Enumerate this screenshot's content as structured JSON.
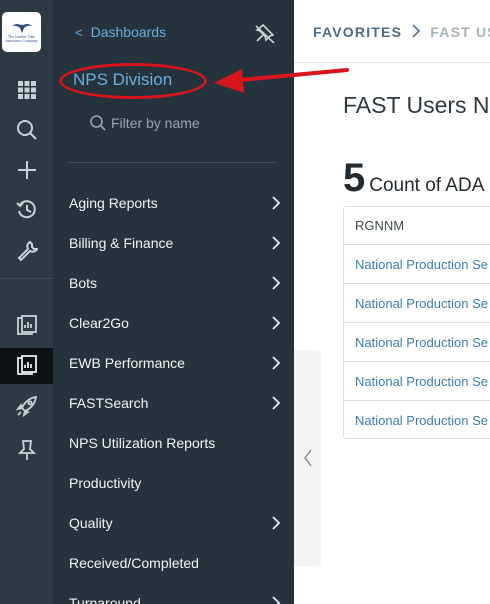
{
  "logo": {
    "text": "The Lender Title Insurance Company"
  },
  "rail": {
    "items": [
      {
        "icon": "apps-grid-icon"
      },
      {
        "icon": "search-icon"
      },
      {
        "icon": "plus-icon"
      },
      {
        "icon": "history-icon"
      },
      {
        "icon": "wrench-icon"
      },
      {
        "icon": "dashboard-icon"
      },
      {
        "icon": "dashboard-icon",
        "active": true
      },
      {
        "icon": "rocket-icon"
      },
      {
        "icon": "pin-icon"
      }
    ]
  },
  "panel": {
    "back_label": "Dashboards",
    "back_chevron": "<",
    "division_title": "NPS Division",
    "filter_placeholder": "Filter by name",
    "items": [
      {
        "label": "Aging Reports",
        "has_children": true
      },
      {
        "label": "Billing & Finance",
        "has_children": true
      },
      {
        "label": "Bots",
        "has_children": true
      },
      {
        "label": "Clear2Go",
        "has_children": true
      },
      {
        "label": "EWB Performance",
        "has_children": true
      },
      {
        "label": "FASTSearch",
        "has_children": true
      },
      {
        "label": "NPS Utilization Reports",
        "has_children": false
      },
      {
        "label": "Productivity",
        "has_children": false
      },
      {
        "label": "Quality",
        "has_children": true
      },
      {
        "label": "Received/Completed",
        "has_children": false
      },
      {
        "label": "Turnaround",
        "has_children": true
      }
    ]
  },
  "breadcrumb": {
    "items": [
      "FAVORITES",
      "FAST US"
    ]
  },
  "main": {
    "title": "FAST Users No",
    "kpi_value": "5",
    "kpi_caption": "Count of ADA"
  },
  "table": {
    "header": "RGNNM",
    "rows": [
      "National Production Se",
      "National Production Se",
      "National Production Se",
      "National Production Se",
      "National Production Se"
    ]
  },
  "colors": {
    "rail": "#2b3a43",
    "panel": "#25333c",
    "link": "#6aaede",
    "annotation": "#d8141c"
  }
}
